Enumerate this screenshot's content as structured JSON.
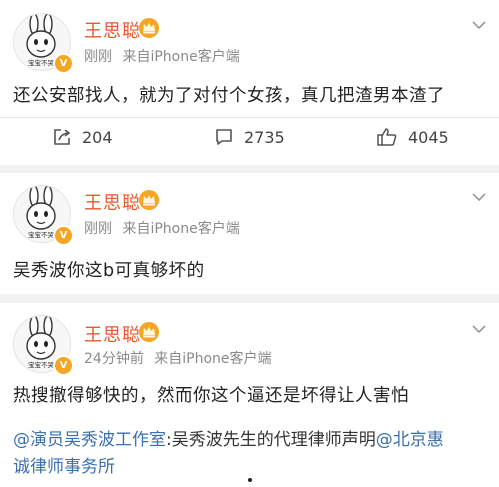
{
  "posts": [
    {
      "user": "王思聪",
      "time": "刚刚",
      "source": "来自iPhone客户端",
      "text": "还公安部找人，就为了对付个女孩，真几把渣男本渣了",
      "forwards": "204",
      "comments": "2735",
      "likes": "4045"
    },
    {
      "user": "王思聪",
      "time": "刚刚",
      "source": "来自iPhone客户端",
      "text": "吴秀波你这b可真够坏的"
    },
    {
      "user": "王思聪",
      "time": "24分钟前",
      "source": "来自iPhone客户端",
      "text": "热搜撤得够快的，然而你这个逼还是坏得让人害怕",
      "repost": {
        "mention1": "@演员吴秀波工作室",
        "middle": ":吴秀波先生的代理律师声明",
        "mention2_part1": "@北京惠",
        "mention2_part2": "诚律师事务所"
      }
    }
  ],
  "icons": {
    "avatar": "rabbit-avatar",
    "verified": "v-badge",
    "crown": "crown-icon",
    "chevron": "chevron-down-icon",
    "forward": "forward-icon",
    "comment": "comment-icon",
    "like": "thumbs-up-icon"
  },
  "avatar_caption": "宝宝不哭",
  "colors": {
    "username": "#e8592d",
    "meta": "#8a8a8a",
    "link": "#3a6fb0",
    "badge": "#f6a623"
  }
}
